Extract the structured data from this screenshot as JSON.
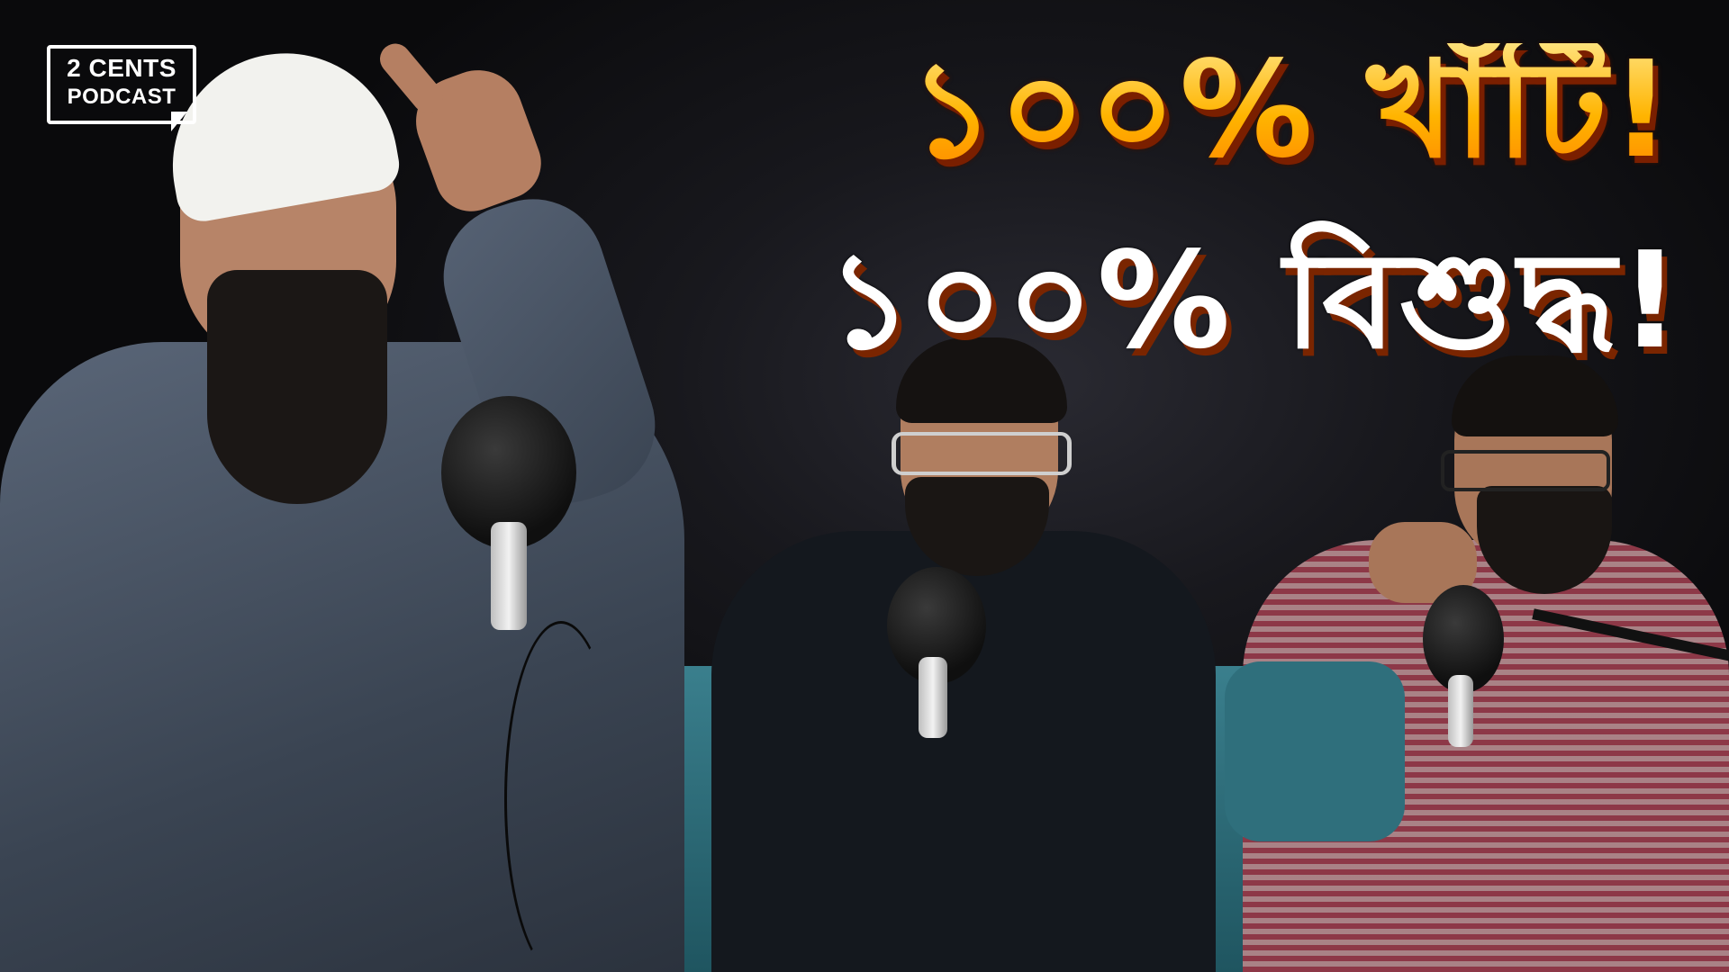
{
  "logo": {
    "line1": "2 CENTS",
    "line2": "PODCAST"
  },
  "headline": {
    "line1": "১০০% খাঁটি!",
    "line2": "১০০% বিশুদ্ধ!"
  },
  "colors": {
    "headline1_fill": "#ffb400",
    "headline2_fill": "#ffffff",
    "headline_shadow": "#7a2500",
    "background": "#0c0c10"
  }
}
